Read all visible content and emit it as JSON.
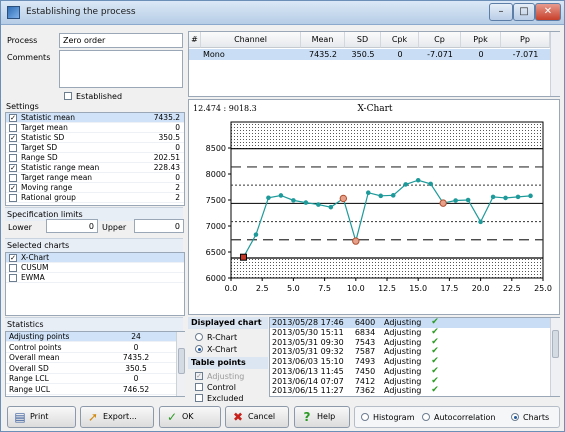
{
  "window": {
    "title": "Establishing the process",
    "controls": {
      "minimize": "–",
      "maximize": "□",
      "close": "✕"
    }
  },
  "process": {
    "process_label": "Process",
    "process_value": "Zero order",
    "comments_label": "Comments",
    "comments_value": "",
    "established_label": "Established",
    "established_checked": false
  },
  "settings": {
    "title": "Settings",
    "items": [
      {
        "label": "Statistic mean",
        "value": "7435.2",
        "checked": true,
        "selected": true
      },
      {
        "label": "Target mean",
        "value": "0",
        "checked": false
      },
      {
        "label": "Statistic SD",
        "value": "350.5",
        "checked": true
      },
      {
        "label": "Target SD",
        "value": "0",
        "checked": false
      },
      {
        "label": "Range SD",
        "value": "202.51",
        "checked": false
      },
      {
        "label": "Statistic range mean",
        "value": "228.43",
        "checked": true
      },
      {
        "label": "Target range mean",
        "value": "0",
        "checked": false
      },
      {
        "label": "Moving range",
        "value": "2",
        "checked": true
      },
      {
        "label": "Rational group",
        "value": "2",
        "checked": false
      }
    ]
  },
  "spec_limits": {
    "title": "Specification limits",
    "lower_label": "Lower",
    "lower_value": "0",
    "upper_label": "Upper",
    "upper_value": "0"
  },
  "selected_charts": {
    "title": "Selected charts",
    "items": [
      {
        "label": "X-Chart",
        "checked": true,
        "selected": true
      },
      {
        "label": "CUSUM",
        "checked": false
      },
      {
        "label": "EWMA",
        "checked": false
      }
    ]
  },
  "statistics": {
    "title": "Statistics",
    "items": [
      {
        "label": "Adjusting points",
        "value": "24",
        "selected": true
      },
      {
        "label": "Control points",
        "value": "0"
      },
      {
        "label": "Overall mean",
        "value": "7435.2"
      },
      {
        "label": "Overall SD",
        "value": "350.5"
      },
      {
        "label": "Range LCL",
        "value": "0"
      },
      {
        "label": "Range UCL",
        "value": "746.52"
      }
    ]
  },
  "channel_table": {
    "headers": [
      "#",
      "Channel",
      "Mean",
      "SD",
      "Cpk",
      "Cp",
      "Ppk",
      "Pp"
    ],
    "rows": [
      [
        "",
        "Mono",
        "7435.2",
        "350.5",
        "0",
        "-7.071",
        "0",
        "-7.071"
      ]
    ]
  },
  "chart": {
    "coord_readout": "12.474 : 9018.3",
    "title": "X-Chart"
  },
  "chart_data": {
    "type": "line",
    "title": "X-Chart",
    "xlim": [
      0,
      25
    ],
    "ylim": [
      6000,
      9000
    ],
    "x_ticks": [
      "0.0",
      "2.5",
      "5.0",
      "7.5",
      "10.0",
      "12.5",
      "15.0",
      "17.5",
      "20.0",
      "22.5",
      "25.0"
    ],
    "y_ticks": [
      "6000",
      "6500",
      "7000",
      "7500",
      "8000",
      "8500"
    ],
    "mean_line": 7435.2,
    "dashed_lines": [
      6735,
      8136
    ],
    "dotted_lines": [
      7085,
      7786
    ],
    "solid_limits": [
      6384,
      8487
    ],
    "x": [
      1,
      2,
      3,
      4,
      5,
      6,
      7,
      8,
      9,
      10,
      11,
      12,
      13,
      14,
      15,
      16,
      17,
      18,
      19,
      20,
      21,
      22,
      23,
      24
    ],
    "values": [
      6400,
      6834,
      7543,
      7587,
      7493,
      7450,
      7412,
      7362,
      7530,
      6710,
      7640,
      7580,
      7590,
      7800,
      7880,
      7810,
      7440,
      7490,
      7500,
      7080,
      7560,
      7540,
      7560,
      7580
    ],
    "highlighted_points": [
      1,
      9,
      10,
      17
    ],
    "grid": false,
    "color": "#1f9a9a"
  },
  "displayed_chart": {
    "title": "Displayed chart",
    "options": [
      {
        "label": "R-Chart",
        "selected": false
      },
      {
        "label": "X-Chart",
        "selected": true
      }
    ]
  },
  "table_points": {
    "title": "Table points",
    "options": [
      {
        "label": "Adjusting",
        "checked": true,
        "disabled": true
      },
      {
        "label": "Control",
        "checked": false
      },
      {
        "label": "Excluded",
        "checked": false
      }
    ]
  },
  "points_table": {
    "rows": [
      {
        "date": "2013/05/28 17:46",
        "value": "6400",
        "status": "Adjusting",
        "selected": true
      },
      {
        "date": "2013/05/30 15:11",
        "value": "6834",
        "status": "Adjusting"
      },
      {
        "date": "2013/05/31 09:30",
        "value": "7543",
        "status": "Adjusting"
      },
      {
        "date": "2013/05/31 09:32",
        "value": "7587",
        "status": "Adjusting"
      },
      {
        "date": "2013/06/03 15:10",
        "value": "7493",
        "status": "Adjusting"
      },
      {
        "date": "2013/06/13 11:45",
        "value": "7450",
        "status": "Adjusting"
      },
      {
        "date": "2013/06/14 07:07",
        "value": "7412",
        "status": "Adjusting"
      },
      {
        "date": "2013/06/15 11:27",
        "value": "7362",
        "status": "Adjusting"
      }
    ]
  },
  "bottom_bar": {
    "print": "Print",
    "export": "Export...",
    "ok": "OK",
    "cancel": "Cancel",
    "help": "Help",
    "view_options": [
      {
        "label": "Histogram",
        "selected": false
      },
      {
        "label": "Autocorrelation",
        "selected": false
      },
      {
        "label": "Charts",
        "selected": true
      }
    ]
  }
}
